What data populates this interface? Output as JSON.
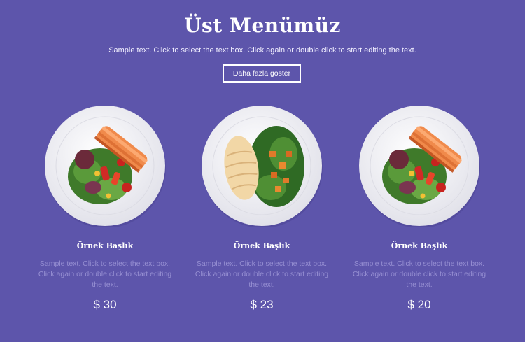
{
  "header": {
    "title": "Üst Menümüz",
    "subtitle": "Sample text. Click to select the text box. Click again or double click to start editing the text.",
    "cta_label": "Daha fazla göster"
  },
  "colors": {
    "background": "#5d55ab",
    "muted_text": "#968fd2",
    "plate": "#eeeef3"
  },
  "menu_items": [
    {
      "title": "Örnek Başlık",
      "description": "Sample text. Click to select the text box. Click again or double click to start editing the text.",
      "price": "$ 30",
      "image": "salmon-salad-plate"
    },
    {
      "title": "Örnek Başlık",
      "description": "Sample text. Click to select the text box. Click again or double click to start editing the text.",
      "price": "$ 23",
      "image": "chicken-salad-plate"
    },
    {
      "title": "Örnek Başlık",
      "description": "Sample text. Click to select the text box. Click again or double click to start editing the text.",
      "price": "$ 20",
      "image": "salmon-salad-plate"
    }
  ]
}
